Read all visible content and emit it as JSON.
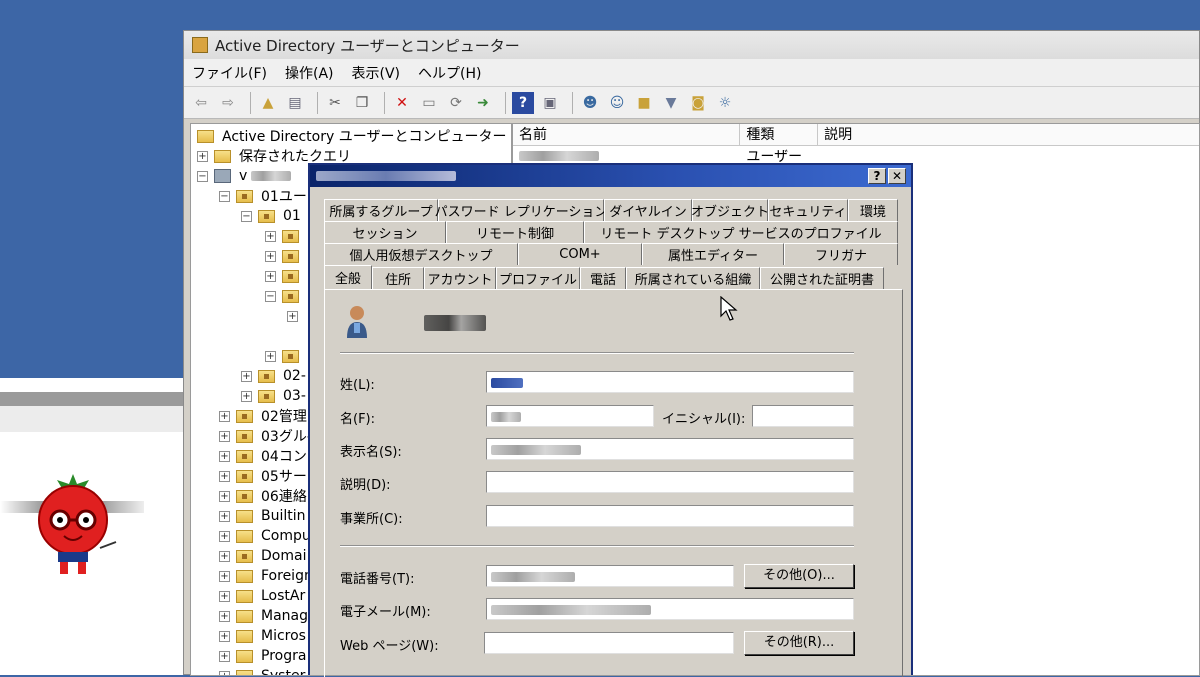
{
  "window": {
    "title": "Active Directory ユーザーとコンピューター"
  },
  "menu": [
    "ファイル(F)",
    "操作(A)",
    "表示(V)",
    "ヘルプ(H)"
  ],
  "toolbar_icons": [
    "back-arrow-icon",
    "forward-arrow-icon",
    "up-folder-icon",
    "show-console-tree-icon",
    "cut-icon",
    "copy-icon",
    "delete-icon",
    "properties-icon",
    "refresh-icon",
    "export-list-icon",
    "help-icon",
    "console-icon",
    "new-user-icon",
    "new-group-icon",
    "new-ou-icon",
    "filter-icon",
    "find-icon",
    "add-to-group-icon"
  ],
  "tree": {
    "root": "Active Directory ユーザーとコンピューター [adtok",
    "saved_queries": "保存されたクエリ",
    "domain": "v",
    "nodes": {
      "n01": "01ユー",
      "n01a": "01",
      "n02a": "02-",
      "n03a": "03-",
      "n02": "02管理",
      "n03": "03グル-",
      "n04": "04コンヒ",
      "n05": "05サー",
      "n06": "06連絡",
      "builtin": "Builtin",
      "computers": "Compu",
      "domain_ctrl": "Domai",
      "foreign": "Foreign",
      "lostandfound": "LostAr",
      "managed": "Manag",
      "microsoft": "Micros",
      "program": "Progra",
      "system": "Syster"
    }
  },
  "list": {
    "columns": [
      "名前",
      "種類",
      "説明"
    ],
    "rows": [
      {
        "name": "",
        "type": "ユーザー",
        "desc": ""
      }
    ]
  },
  "dialog": {
    "title": "",
    "help_btn": "?",
    "close_btn": "✕",
    "tabs_row1": [
      "所属するグループ",
      "パスワード レプリケーション",
      "ダイヤルイン",
      "オブジェクト",
      "セキュリティ",
      "環境"
    ],
    "tabs_row2": [
      "セッション",
      "リモート制御",
      "リモート デスクトップ サービスのプロファイル"
    ],
    "tabs_row3": [
      "個人用仮想デスクトップ",
      "COM+",
      "属性エディター",
      "フリガナ"
    ],
    "tabs_row4": [
      "全般",
      "住所",
      "アカウント",
      "プロファイル",
      "電話",
      "所属されている組織",
      "公開された証明書"
    ],
    "labels": {
      "last_name": "姓(L):",
      "first_name": "名(F):",
      "initials": "イニシャル(I):",
      "display_name": "表示名(S):",
      "description": "説明(D):",
      "office": "事業所(C):",
      "phone": "電話番号(T):",
      "email": "電子メール(M):",
      "web": "Web ページ(W):"
    },
    "buttons": {
      "phone_other": "その他(O)...",
      "web_other": "その他(R)..."
    }
  },
  "colors": {
    "desktop": "#3d66a6",
    "dialog_title": "#0a246a",
    "face": "#d4d0c8"
  }
}
